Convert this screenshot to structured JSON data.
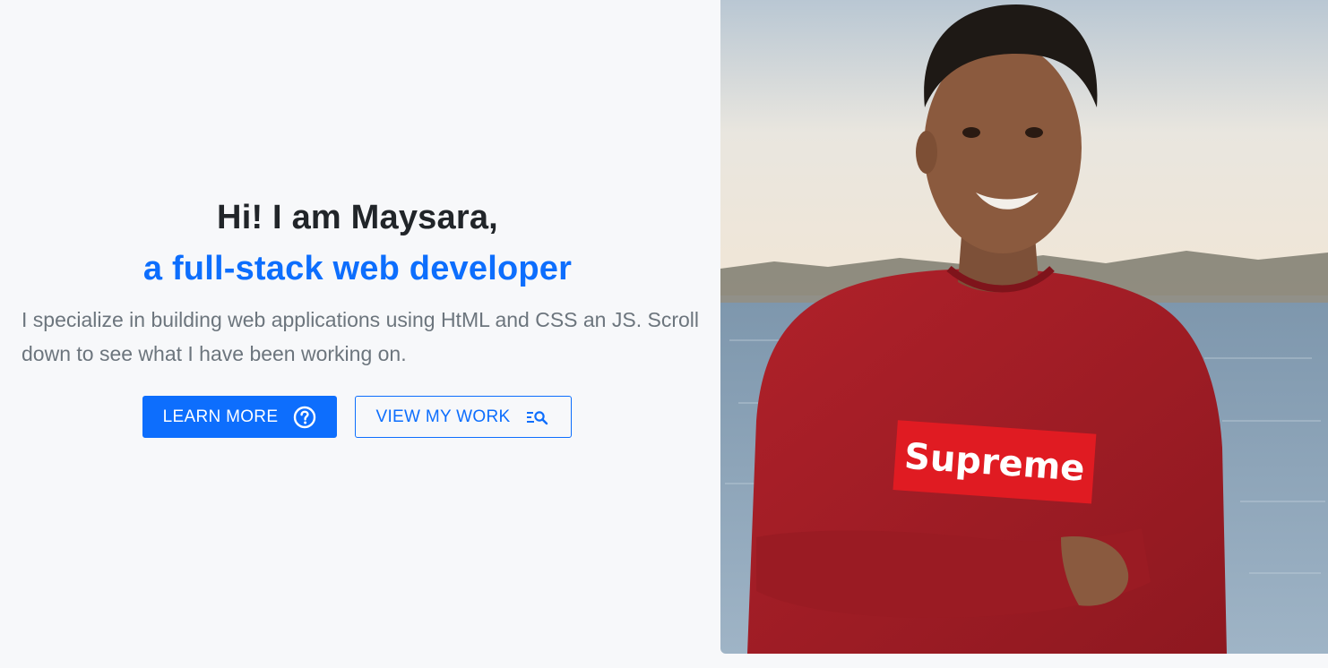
{
  "hero": {
    "greeting": "Hi! I am Maysara,",
    "role": "a full-stack web developer",
    "description": "I specialize in building web applications using HtML and CSS an JS. Scroll down to see what I have been working on.",
    "buttons": {
      "learn_more": {
        "label": "LEARN MORE",
        "icon": "question-circle-icon"
      },
      "view_work": {
        "label": "VIEW MY WORK",
        "icon": "list-search-icon"
      }
    }
  },
  "photo": {
    "shirt_logo_text": "Supreme"
  },
  "colors": {
    "primary": "#0d6efd",
    "heading": "#212529",
    "muted": "#6c757d",
    "background": "#f7f8fa"
  }
}
